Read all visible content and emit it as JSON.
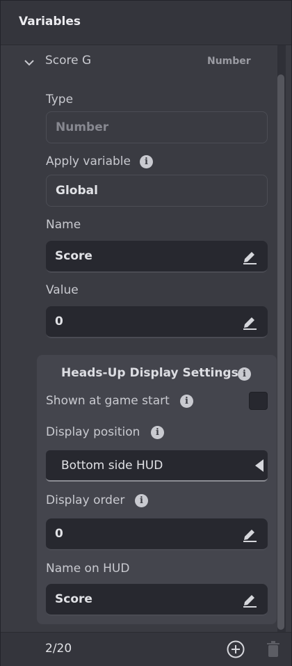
{
  "panel": {
    "title": "Variables"
  },
  "variable": {
    "name": "Score G",
    "type_badge": "Number",
    "fields": {
      "type": {
        "label": "Type",
        "value": "Number"
      },
      "apply": {
        "label": "Apply variable",
        "value": "Global"
      },
      "name": {
        "label": "Name",
        "value": "Score"
      },
      "value": {
        "label": "Value",
        "value": "0"
      }
    }
  },
  "hud": {
    "title": "Heads-Up Display Settings",
    "shown_label": "Shown at game start",
    "shown_checked": false,
    "position_label": "Display position",
    "position_value": "Bottom side HUD",
    "order_label": "Display order",
    "order_value": "0",
    "name_label": "Name on HUD",
    "name_value": "Score"
  },
  "footer": {
    "count": "2/20"
  },
  "icons": {
    "chevron": "chevron-down-icon",
    "info": "info-icon",
    "pencil": "pencil-icon",
    "add": "plus-circle-icon",
    "trash": "trash-icon",
    "dropdown": "triangle-left-icon"
  }
}
